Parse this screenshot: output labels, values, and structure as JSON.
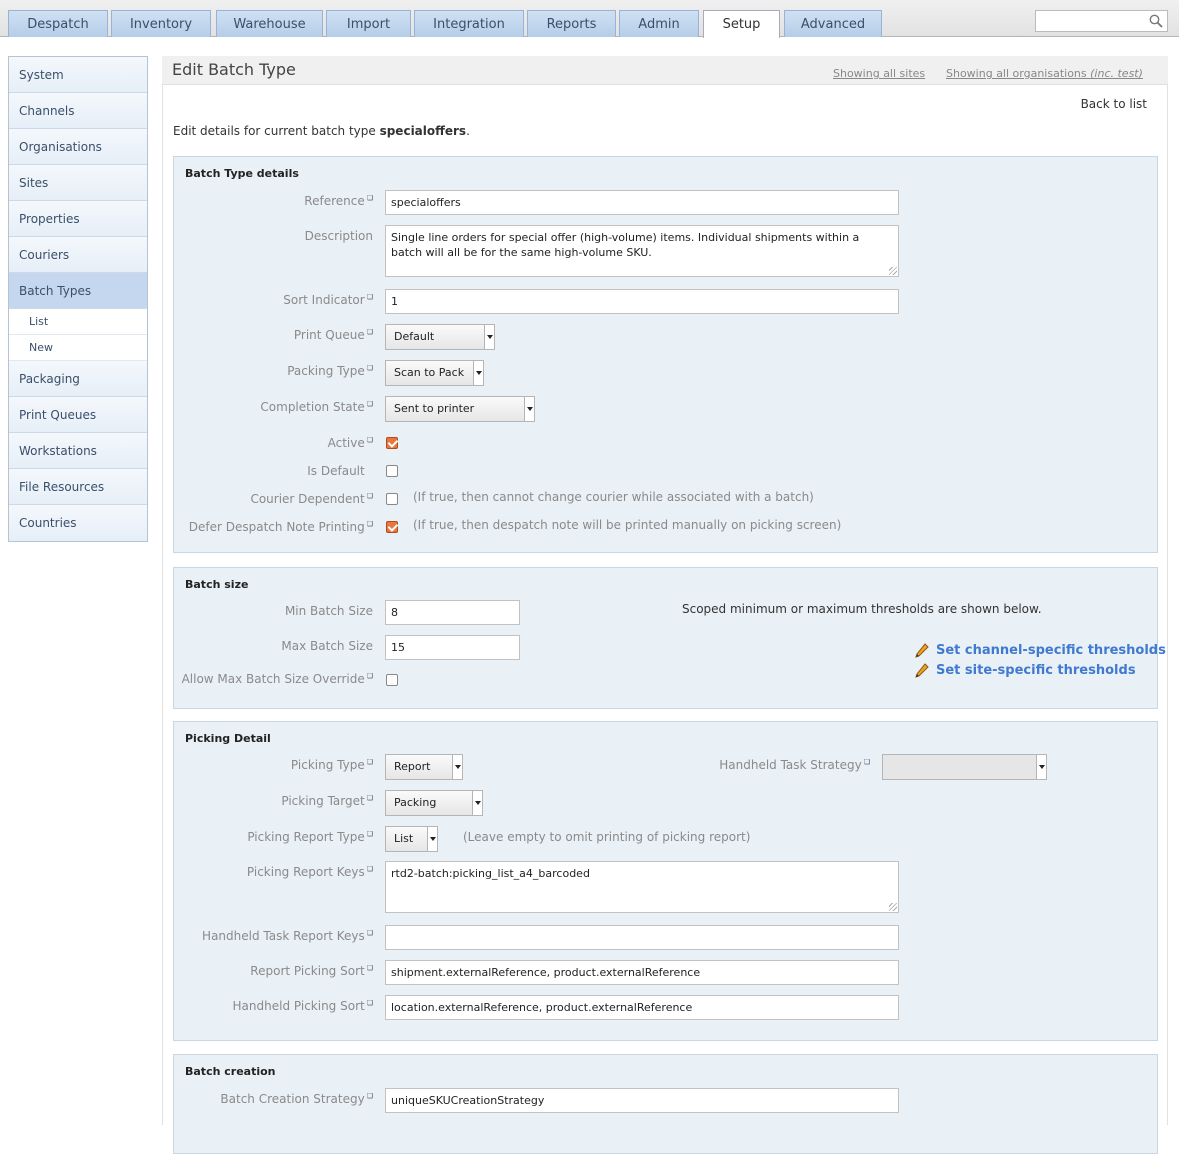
{
  "nav": {
    "tabs": [
      "Despatch",
      "Inventory",
      "Warehouse",
      "Import",
      "Integration",
      "Reports",
      "Admin",
      "Setup",
      "Advanced"
    ],
    "active_tab": "Setup",
    "search_placeholder": ""
  },
  "sidebar": {
    "items": [
      "System",
      "Channels",
      "Organisations",
      "Sites",
      "Properties",
      "Couriers",
      "Batch Types",
      "Packaging",
      "Print Queues",
      "Workstations",
      "File Resources",
      "Countries"
    ],
    "active": "Batch Types",
    "subitems": [
      "List",
      "New"
    ]
  },
  "header": {
    "title": "Edit Batch Type",
    "showing_sites": "Showing all sites",
    "showing_orgs_prefix": "Showing all organisations ",
    "showing_orgs_suffix": "(inc. test)"
  },
  "page": {
    "back_link": "Back to list",
    "intro_prefix": "Edit details for current batch type ",
    "intro_name": "specialoffers",
    "intro_suffix": "."
  },
  "batch_type_details": {
    "title": "Batch Type details",
    "reference_label": "Reference",
    "reference_value": "specialoffers",
    "description_label": "Description",
    "description_value": "Single line orders for special offer (high-volume) items.  Individual shipments within a batch will all be for the same high-volume SKU.",
    "sort_label": "Sort Indicator",
    "sort_value": "1",
    "print_queue_label": "Print Queue",
    "print_queue_value": "Default",
    "packing_type_label": "Packing Type",
    "packing_type_value": "Scan to Pack",
    "completion_label": "Completion State",
    "completion_value": "Sent to printer",
    "active_label": "Active",
    "active_checked": true,
    "default_label": "Is Default",
    "default_checked": false,
    "courier_dep_label": "Courier Dependent",
    "courier_dep_checked": false,
    "courier_dep_hint": "(If true, then cannot change courier while associated with a batch)",
    "defer_label": "Defer Despatch Note Printing",
    "defer_checked": true,
    "defer_hint": "(If true, then despatch note will be printed manually on picking screen)"
  },
  "batch_size": {
    "title": "Batch size",
    "min_label": "Min Batch Size",
    "min_value": "8",
    "max_label": "Max Batch Size",
    "max_value": "15",
    "override_label": "Allow Max Batch Size Override",
    "override_checked": false,
    "scoped_note": "Scoped minimum or maximum thresholds are shown below.",
    "channel_link": "Set channel-specific thresholds",
    "site_link": "Set site-specific thresholds"
  },
  "picking": {
    "title": "Picking Detail",
    "type_label": "Picking Type",
    "type_value": "Report",
    "strategy_label": "Handheld Task Strategy",
    "strategy_value": "",
    "target_label": "Picking Target",
    "target_value": "Packing",
    "report_type_label": "Picking Report Type",
    "report_type_value": "List",
    "report_type_hint": "(Leave empty to omit printing of picking report)",
    "report_keys_label": "Picking Report Keys",
    "report_keys_value": "rtd2-batch:picking_list_a4_barcoded",
    "handheld_keys_label": "Handheld Task Report Keys",
    "handheld_keys_value": "",
    "report_sort_label": "Report Picking Sort",
    "report_sort_value": "shipment.externalReference, product.externalReference",
    "handheld_sort_label": "Handheld Picking Sort",
    "handheld_sort_value": "location.externalReference, product.externalReference"
  },
  "batch_creation": {
    "title": "Batch creation",
    "strategy_label": "Batch Creation Strategy",
    "strategy_value": "uniqueSKUCreationStrategy"
  }
}
